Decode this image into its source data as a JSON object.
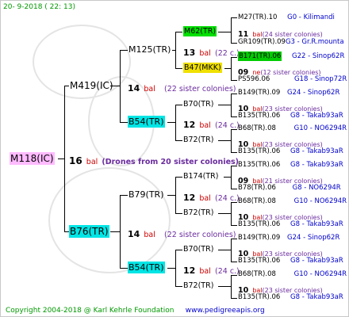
{
  "header": {
    "date": "20-  9-2018 ( 22: 13)"
  },
  "footer": {
    "copyright": "Copyright 2004-2018 @ Karl Kehrle Foundation",
    "url": "www.pedigreeapis.org"
  },
  "root": {
    "name": "M118(IC)",
    "num": "16",
    "bal": "bal",
    "note": "(Drones from 20 sister colonies)"
  },
  "gen1": [
    {
      "name": "M419(IC)",
      "num": "14",
      "bal": "bal",
      "note": "(22 sister colonies)"
    },
    {
      "name": "B76(TR)",
      "num": "14",
      "bal": "bal",
      "note": "(22 sister colonies)"
    }
  ],
  "gen2": [
    {
      "name": "M125(TR)",
      "num": "13",
      "bal": "bal",
      "note": "(22 c.)"
    },
    {
      "name": "B54(TR)",
      "num": "12",
      "bal": "bal",
      "note": "(24 c.)"
    },
    {
      "name": "B79(TR)",
      "num": "12",
      "bal": "bal",
      "note": "(24 c.)"
    },
    {
      "name": "B54(TR)",
      "num": "12",
      "bal": "bal",
      "note": "(24 c.)"
    }
  ],
  "gen3": [
    {
      "name": "M62(TR)"
    },
    {
      "name": "B47(MKK)"
    },
    {
      "name": "B70(TR)"
    },
    {
      "name": "B72(TR)"
    },
    {
      "name": "B174(TR)"
    },
    {
      "name": "B72(TR)"
    },
    {
      "name": "B70(TR)"
    },
    {
      "name": "B72(TR)"
    }
  ],
  "gen4": [
    {
      "name": "M27(TR).10",
      "loc": "G0 - Kilimandi",
      "num": "11",
      "bal": "bal",
      "note": "(24 sister colonies)",
      "name2": "GR109(TR).09",
      "loc2": "G3 - Gr.R.mounta"
    },
    {
      "name": "B171(TR).06",
      "loc": "G22 - Sinop62R",
      "num": "09",
      "bal": "ne",
      "note": "(12 sister colonies)",
      "name2": "PS596.06",
      "loc2": "G18 - Sinop72R"
    },
    {
      "name": "B149(TR).09",
      "loc": "G24 - Sinop62R",
      "num": "10",
      "bal": "bal",
      "note": "(23 sister colonies)",
      "name2": "B135(TR).06",
      "loc2": "G8 - Takab93aR"
    },
    {
      "name": "B68(TR).08",
      "loc": "G10 - NO6294R",
      "num": "10",
      "bal": "bal",
      "note": "(23 sister colonies)",
      "name2": "B135(TR).06",
      "loc2": "G8 - Takab93aR"
    },
    {
      "name": "B135(TR).06",
      "loc": "G8 - Takab93aR",
      "num": "09",
      "bal": "bal",
      "note": "(21 sister colonies)",
      "name2": "B78(TR).06",
      "loc2": "G8 - NO6294R"
    },
    {
      "name": "B68(TR).08",
      "loc": "G10 - NO6294R",
      "num": "10",
      "bal": "bal",
      "note": "(23 sister colonies)",
      "name2": "B135(TR).06",
      "loc2": "G8 - Takab93aR"
    },
    {
      "name": "B149(TR).09",
      "loc": "G24 - Sinop62R",
      "num": "10",
      "bal": "bal",
      "note": "(23 sister colonies)",
      "name2": "B135(TR).06",
      "loc2": "G8 - Takab93aR"
    },
    {
      "name": "B68(TR).08",
      "loc": "G10 - NO6294R",
      "num": "10",
      "bal": "bal",
      "note": "(23 sister colonies)",
      "name2": "B135(TR).06",
      "loc2": "G8 - Takab93aR"
    }
  ]
}
